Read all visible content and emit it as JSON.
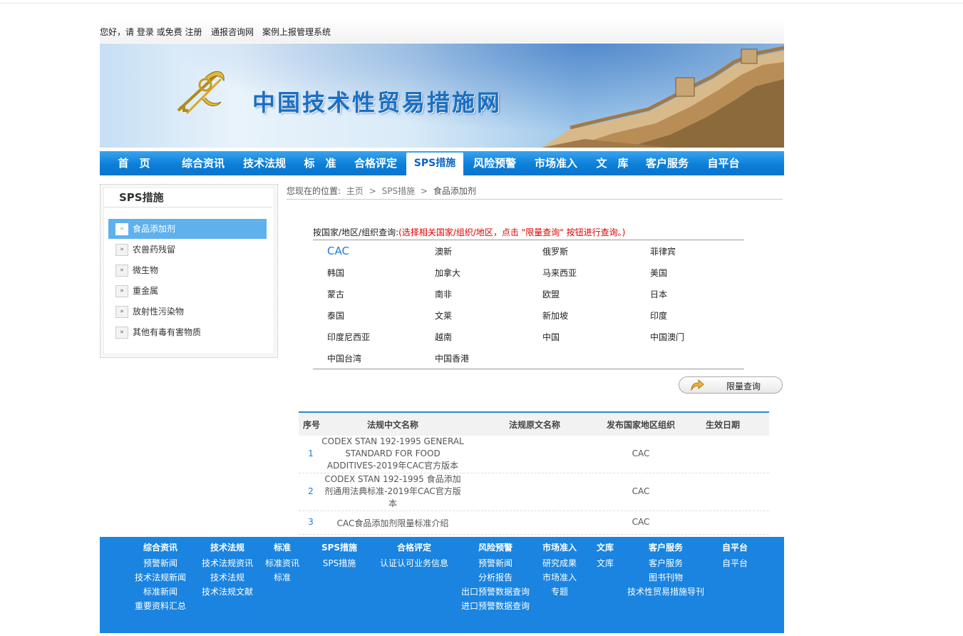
{
  "top_bar": {
    "greeting": "您好，请 登录 或免费 注册",
    "links": [
      "通报咨询网",
      "案例上报管理系统"
    ]
  },
  "banner": {
    "site_title": "中国技术性贸易措施网"
  },
  "nav": {
    "items": [
      "首　页",
      "综合资讯",
      "技术法规",
      "标　准",
      "合格评定",
      "SPS措施",
      "风险预警",
      "市场准入",
      "文　库",
      "客户服务",
      "自平台"
    ],
    "active": "SPS措施"
  },
  "sidebar": {
    "title": "SPS措施",
    "items": [
      "食品添加剂",
      "农兽药残留",
      "微生物",
      "重金属",
      "放射性污染物",
      "其他有毒有害物质"
    ],
    "active": "食品添加剂"
  },
  "breadcrumb": {
    "prefix": "您现在的位置:",
    "items": [
      "主页",
      "SPS措施",
      "食品添加剂"
    ],
    "sep": ">"
  },
  "country_query": {
    "label": "按国家/地区/组织查询:",
    "hint": "(选择相关国家/组织/地区，点击 \"限量查询\" 按钮进行查询。)",
    "countries": [
      "CAC",
      "澳新",
      "俄罗斯",
      "菲律宾",
      "韩国",
      "加拿大",
      "马来西亚",
      "美国",
      "蒙古",
      "南非",
      "欧盟",
      "日本",
      "泰国",
      "文莱",
      "新加坡",
      "印度",
      "印度尼西亚",
      "越南",
      "中国",
      "中国澳门",
      "中国台湾",
      "中国香港"
    ],
    "button": "限量查询"
  },
  "results": {
    "headers": [
      "序号",
      "法规中文名称",
      "法规原文名称",
      "发布国家地区组织",
      "生效日期"
    ],
    "rows": [
      {
        "no": "1",
        "name_cn": "CODEX STAN 192-1995 GENERAL STANDARD FOR FOOD ADDITIVES-2019年CAC官方版本",
        "name_orig": "",
        "org": "CAC",
        "date": ""
      },
      {
        "no": "2",
        "name_cn": "CODEX STAN 192-1995 食品添加剂通用法典标准-2019年CAC官方版本",
        "name_orig": "",
        "org": "CAC",
        "date": ""
      },
      {
        "no": "3",
        "name_cn": "CAC食品添加剂限量标准介绍",
        "name_orig": "",
        "org": "CAC",
        "date": ""
      }
    ]
  },
  "footer": {
    "columns": [
      {
        "title": "综合资讯",
        "links": [
          "预警新闻",
          "技术法规新闻",
          "标准新闻",
          "重要资料汇总"
        ]
      },
      {
        "title": "技术法规",
        "links": [
          "技术法规资讯",
          "技术法规",
          "技术法规文献"
        ]
      },
      {
        "title": "标准",
        "links": [
          "标准资讯",
          "标准"
        ]
      },
      {
        "title": "SPS措施",
        "links": [
          "SPS措施"
        ]
      },
      {
        "title": "合格评定",
        "links": [
          "认证认可业务信息"
        ]
      },
      {
        "title": "风险预警",
        "links": [
          "预警新闻",
          "分析报告",
          "出口预警数据查询",
          "进口预警数据查询"
        ]
      },
      {
        "title": "市场准入",
        "links": [
          "研究成果",
          "市场准入",
          "专题"
        ]
      },
      {
        "title": "文库",
        "links": [
          "文库"
        ]
      },
      {
        "title": "客户服务",
        "links": [
          "客户服务",
          "图书刊物",
          "技术性贸易措施导刊"
        ]
      },
      {
        "title": "自平台",
        "links": [
          "自平台"
        ]
      }
    ]
  },
  "colors": {
    "nav_blue": "#0b7fd9",
    "footer_blue": "#1a84e0",
    "active_side": "#5fb1ee",
    "hint_red": "#dd0000",
    "link_blue": "#1a7fd6"
  }
}
